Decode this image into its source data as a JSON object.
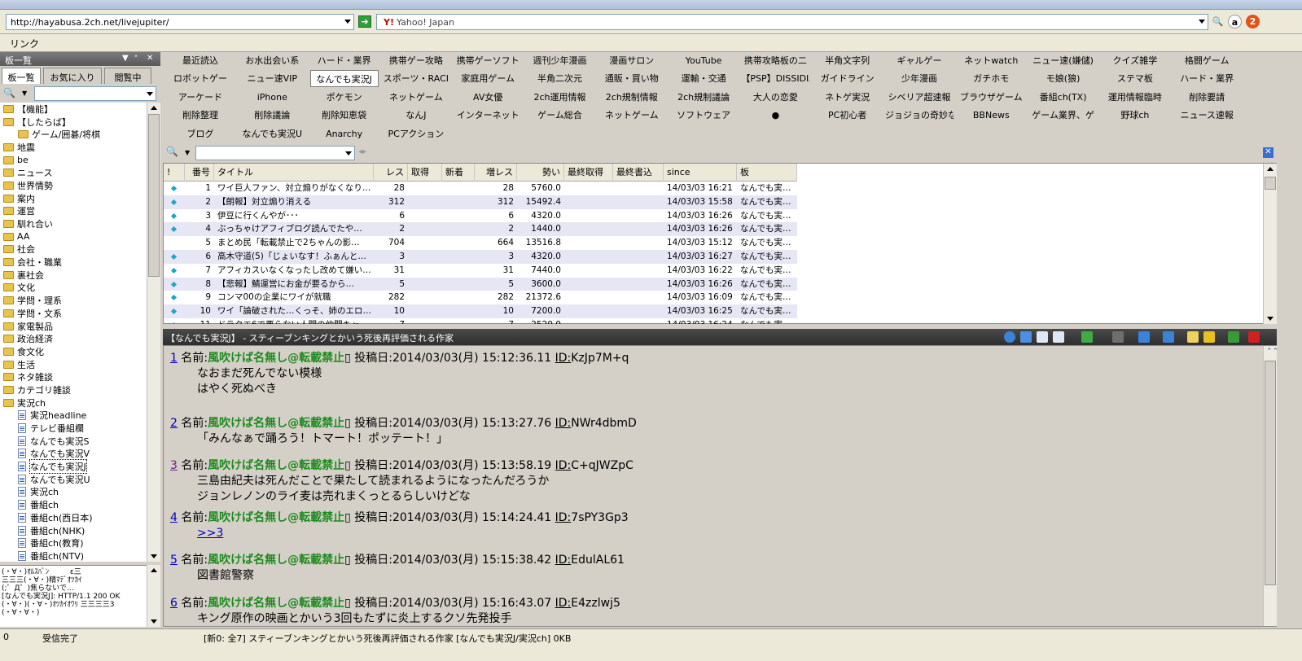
{
  "address": {
    "url": "http://hayabusa.2ch.net/livejupiter/",
    "search_label": "Yahoo!  Japan",
    "search_icon_text": "Y!"
  },
  "links_bar": {
    "label": "リンク"
  },
  "left_panel": {
    "title": "板一覧",
    "tabs": [
      "板一覧",
      "お気に入り",
      "閲覧中"
    ],
    "tree": [
      {
        "label": "【機能】",
        "type": "folder",
        "indent": 0
      },
      {
        "label": "【したらば】",
        "type": "folder",
        "indent": 0
      },
      {
        "label": "ゲーム/囲碁/将棋",
        "type": "folder",
        "indent": 1
      },
      {
        "label": "地震",
        "type": "folder",
        "indent": 0
      },
      {
        "label": "be",
        "type": "folder",
        "indent": 0
      },
      {
        "label": "ニュース",
        "type": "folder",
        "indent": 0
      },
      {
        "label": "世界情勢",
        "type": "folder",
        "indent": 0
      },
      {
        "label": "案内",
        "type": "folder",
        "indent": 0
      },
      {
        "label": "運営",
        "type": "folder",
        "indent": 0
      },
      {
        "label": "馴れ合い",
        "type": "folder",
        "indent": 0
      },
      {
        "label": "AA",
        "type": "folder",
        "indent": 0
      },
      {
        "label": "社会",
        "type": "folder",
        "indent": 0
      },
      {
        "label": "会社・職業",
        "type": "folder",
        "indent": 0
      },
      {
        "label": "裏社会",
        "type": "folder",
        "indent": 0
      },
      {
        "label": "文化",
        "type": "folder",
        "indent": 0
      },
      {
        "label": "学問・理系",
        "type": "folder",
        "indent": 0
      },
      {
        "label": "学問・文系",
        "type": "folder",
        "indent": 0
      },
      {
        "label": "家電製品",
        "type": "folder",
        "indent": 0
      },
      {
        "label": "政治経済",
        "type": "folder",
        "indent": 0
      },
      {
        "label": "食文化",
        "type": "folder",
        "indent": 0
      },
      {
        "label": "生活",
        "type": "folder",
        "indent": 0
      },
      {
        "label": "ネタ雑談",
        "type": "folder",
        "indent": 0
      },
      {
        "label": "カテゴリ雑談",
        "type": "folder",
        "indent": 0
      },
      {
        "label": "実況ch",
        "type": "folder",
        "indent": 0
      },
      {
        "label": "実況headline",
        "type": "board",
        "indent": 1
      },
      {
        "label": "テレビ番組欄",
        "type": "board",
        "indent": 1
      },
      {
        "label": "なんでも実況S",
        "type": "board",
        "indent": 1
      },
      {
        "label": "なんでも実況V",
        "type": "board",
        "indent": 1
      },
      {
        "label": "なんでも実況J",
        "type": "board",
        "indent": 1,
        "selected": true
      },
      {
        "label": "なんでも実況U",
        "type": "board",
        "indent": 1
      },
      {
        "label": "実況ch",
        "type": "board",
        "indent": 1
      },
      {
        "label": "番組ch",
        "type": "board",
        "indent": 1
      },
      {
        "label": "番組ch(西日本)",
        "type": "board",
        "indent": 1
      },
      {
        "label": "番組ch(NHK)",
        "type": "board",
        "indent": 1
      },
      {
        "label": "番組ch(教育)",
        "type": "board",
        "indent": 1
      },
      {
        "label": "番組ch(NTV)",
        "type": "board",
        "indent": 1
      }
    ],
    "log": "(・∀・)ｵﾙｽﾊﾞﾝ         ε三\n三三三(・∀・)精ﾏﾃﾞｵﾂｶｲ\n(;゜Д゜)焦らないで…\n[なんでも実況J]: HTTP/1.1 200 OK\n(・∀・)(・∀・)ｵﾂｶｲｵﾜﾘ 三三三三3\n(・∀・∀・)"
  },
  "boards": [
    [
      "最近読込",
      "お水出会い系",
      "ハード・業界",
      "携帯ゲー攻略",
      "携帯ゲーソフト",
      "週刊少年漫画",
      "漫画サロン",
      "YouTube",
      "携帯攻略板の二",
      "半角文字列",
      "ギャルゲー",
      "ネットwatch",
      "ニュー速(嫌儲)",
      "クイズ雑学",
      "格闘ゲーム"
    ],
    [
      "ロボットゲー",
      "ニュー速VIP",
      "なんでも実況J",
      "スポーツ・RACI",
      "家庭用ゲーム",
      "半角二次元",
      "通販・買い物",
      "運輸・交通",
      "【PSP】DISSIDIA",
      "ガイドライン",
      "少年漫画",
      "ガチホモ",
      "モ娘(狼)",
      "ステマ板",
      "ハード・業界"
    ],
    [
      "アーケード",
      "iPhone",
      "ポケモン",
      "ネットゲーム",
      "AV女優",
      "2ch運用情報",
      "2ch規制情報",
      "2ch規制議論",
      "大人の恋愛",
      "ネトゲ実況",
      "シベリア超速報",
      "ブラウザゲーム",
      "番組ch(TX)",
      "運用情報臨時",
      "削除要請"
    ],
    [
      "削除整理",
      "削除議論",
      "削除知恵袋",
      "なんJ",
      "インターネット",
      "ゲーム総合",
      "ネットゲーム",
      "ソフトウェア",
      "●",
      "PC初心者",
      "ジョジョの奇妙な",
      "BBNews",
      "ゲーム業界、ゲ",
      "野球ch",
      "ニュース速報"
    ],
    [
      "ブログ",
      "なんでも実況U",
      "Anarchy",
      "PCアクション"
    ]
  ],
  "active_board": "なんでも実況J",
  "thread_columns": [
    "!",
    "番号",
    "タイトル",
    "レス",
    "取得",
    "新着",
    "増レス",
    "勢い",
    "最終取得",
    "最終書込",
    "since",
    "板"
  ],
  "threads": [
    {
      "mark": true,
      "no": "1",
      "title": "ワイ巨人ファン、対立煽りがなくなり…",
      "res": "28",
      "inc": "28",
      "power": "5760.0",
      "since": "14/03/03 16:21",
      "board": "なんでも実…"
    },
    {
      "mark": true,
      "no": "2",
      "title": "【朗報】対立煽り消える",
      "res": "312",
      "inc": "312",
      "power": "15492.4",
      "since": "14/03/03 15:58",
      "board": "なんでも実…"
    },
    {
      "mark": true,
      "no": "3",
      "title": "伊豆に行くんやが･･･",
      "res": "6",
      "inc": "6",
      "power": "4320.0",
      "since": "14/03/03 16:26",
      "board": "なんでも実…"
    },
    {
      "mark": true,
      "no": "4",
      "title": "ぶっちゃけアフィブログ読んでたや…",
      "res": "2",
      "inc": "2",
      "power": "1440.0",
      "since": "14/03/03 16:26",
      "board": "なんでも実…"
    },
    {
      "mark": false,
      "no": "5",
      "title": "まとめ民「転載禁止で2ちゃんの影…",
      "res": "704",
      "inc": "664",
      "power": "13516.8",
      "since": "14/03/03 15:12",
      "board": "なんでも実…"
    },
    {
      "mark": true,
      "no": "6",
      "title": "高木守道(5)「じょいなす！ふぁんと…",
      "res": "3",
      "inc": "3",
      "power": "4320.0",
      "since": "14/03/03 16:27",
      "board": "なんでも実…"
    },
    {
      "mark": true,
      "no": "7",
      "title": "アフィカスいなくなったし改めて嫌い…",
      "res": "31",
      "inc": "31",
      "power": "7440.0",
      "since": "14/03/03 16:22",
      "board": "なんでも実…"
    },
    {
      "mark": true,
      "no": "8",
      "title": "【悲報】鯖運営にお金が要るから…",
      "res": "5",
      "inc": "5",
      "power": "3600.0",
      "since": "14/03/03 16:26",
      "board": "なんでも実…"
    },
    {
      "mark": true,
      "no": "9",
      "title": "コンマ00の企業にワイが就職",
      "res": "282",
      "inc": "282",
      "power": "21372.6",
      "since": "14/03/03 16:09",
      "board": "なんでも実…"
    },
    {
      "mark": true,
      "no": "10",
      "title": "ワイ「論破された…くっそ、姉のエロ…",
      "res": "10",
      "inc": "10",
      "power": "7200.0",
      "since": "14/03/03 16:25",
      "board": "なんでも実…"
    },
    {
      "mark": true,
      "no": "11",
      "title": "ドラクエ6で悪らない人間の仲間キャ…",
      "res": "7",
      "inc": "7",
      "power": "2520.0",
      "since": "14/03/03 16:24",
      "board": "なんでも実…"
    }
  ],
  "thread_title": "【なんでも実況J】 - スティーブンキングとかいう死後再評価される作家",
  "posts": [
    {
      "no": "1",
      "visited": false,
      "name_label": "名前:",
      "name": "風吹けば名無し@転載禁止",
      "date_label": "投稿日:",
      "date": "2014/03/03(月) 15:12:36.11",
      "id_label": "ID:",
      "id": "KzJp7M+q",
      "lines": [
        "なおまだ死んでない模様",
        "はやく死ぬべき"
      ]
    },
    {
      "no": "2",
      "visited": false,
      "name_label": "名前:",
      "name": "風吹けば名無し@転載禁止",
      "date_label": "投稿日:",
      "date": "2014/03/03(月) 15:13:27.76",
      "id_label": "ID:",
      "id": "NWr4dbmD",
      "lines": [
        "「みんなぁで踊ろう！トマート！ポッテート！」"
      ]
    },
    {
      "no": "3",
      "visited": true,
      "name_label": "名前:",
      "name": "風吹けば名無し@転載禁止",
      "date_label": "投稿日:",
      "date": "2014/03/03(月) 15:13:58.19",
      "id_label": "ID:",
      "id": "C+qJWZpC",
      "lines": [
        "三島由紀夫は死んだことで果たして読まれるようになったんだろうか",
        "ジョンレノンのライ麦は売れまくっとるらしいけどな"
      ]
    },
    {
      "no": "4",
      "visited": false,
      "name_label": "名前:",
      "name": "風吹けば名無し@転載禁止",
      "date_label": "投稿日:",
      "date": "2014/03/03(月) 15:14:24.41",
      "id_label": "ID:",
      "id": "7sPY3Gp3",
      "lines": [],
      "anchor": ">>3"
    },
    {
      "no": "5",
      "visited": false,
      "name_label": "名前:",
      "name": "風吹けば名無し@転載禁止",
      "date_label": "投稿日:",
      "date": "2014/03/03(月) 15:15:38.42",
      "id_label": "ID:",
      "id": "EdulAL61",
      "lines": [
        "図書館警察"
      ]
    },
    {
      "no": "6",
      "visited": false,
      "name_label": "名前:",
      "name": "風吹けば名無し@転載禁止",
      "date_label": "投稿日:",
      "date": "2014/03/03(月) 15:16:43.07",
      "id_label": "ID:",
      "id": "E4zzlwj5",
      "lines": [
        "キング原作の映画とかいう3回もたずに炎上するクソ先発投手"
      ]
    }
  ],
  "status": {
    "count": "0",
    "state": "受信完了",
    "info": "[新0: 全7] スティーブンキングとかいう死後再評価される作家  [なんでも実況J/実況ch]  0KB"
  }
}
